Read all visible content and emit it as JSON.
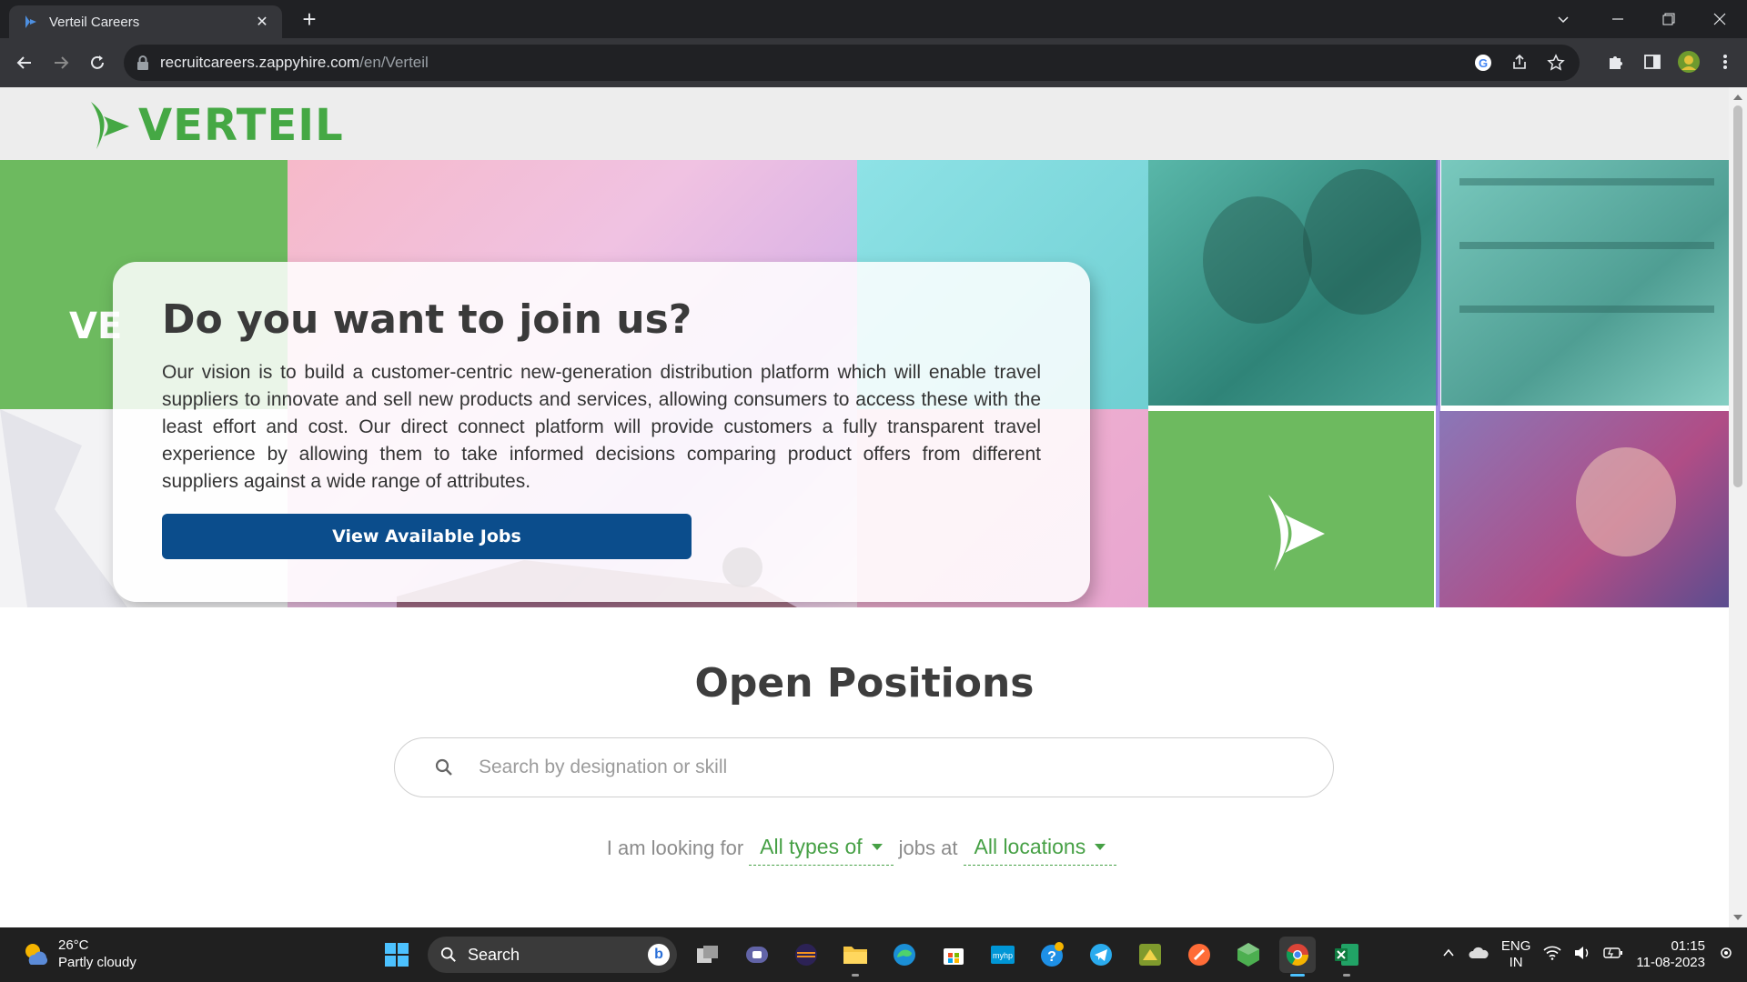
{
  "browser": {
    "tab_title": "Verteil Careers",
    "new_tab": "+",
    "url_host": "recruitcareers.zappyhire.com",
    "url_path": "/en/Verteil"
  },
  "site": {
    "logo_text": "VERTEIL",
    "hero_fragment": "VE",
    "hero_title": "Do you want to join us?",
    "hero_body": "Our vision is to build a customer-centric new-generation distribution platform which will enable travel suppliers to innovate and sell new products and services, allowing consumers to access these with the least effort and cost. Our direct connect platform will provide customers a fully transparent travel experience by allowing them to take informed decisions comparing product offers from different suppliers against a wide range of attributes.",
    "hero_button": "View Available Jobs",
    "section_title": "Open Positions",
    "search_placeholder": "Search by designation or skill",
    "filter_prefix": "I am looking for",
    "filter_type": "All types of",
    "filter_middle": "jobs at",
    "filter_location": "All locations"
  },
  "colors": {
    "brand_green": "#45a844",
    "button_blue": "#0b4d8c"
  },
  "taskbar": {
    "temperature": "26°C",
    "weather": "Partly cloudy",
    "search_label": "Search",
    "bing_label": "b",
    "lang_top": "ENG",
    "lang_bottom": "IN",
    "time": "01:15",
    "date": "11-08-2023",
    "app_icons": [
      "start-icon",
      "search",
      "task-view-icon",
      "teams-icon",
      "eclipse-icon",
      "file-explorer-icon",
      "edge-icon",
      "microsoft-store-icon",
      "myhp-icon",
      "help-icon",
      "telegram-icon",
      "app-icon",
      "postman-icon",
      "app-green-icon",
      "chrome-icon",
      "excel-icon"
    ]
  }
}
